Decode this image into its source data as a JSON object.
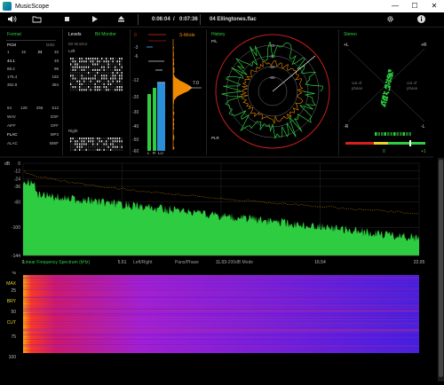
{
  "window": {
    "title": "MusicScope",
    "minimize": "—",
    "maximize": "☐",
    "close": "✕"
  },
  "toolbar": {
    "elapsed": "0:06:04",
    "separator": "/",
    "total": "0:07:36",
    "track": "04 Ellingtones.flac"
  },
  "format": {
    "title": "Format",
    "header_left": "PCM",
    "header_right": "DSD",
    "bits": [
      "1",
      "16",
      "24",
      "32"
    ],
    "rates_left": [
      "44.1",
      "88.2",
      "176.4",
      "352.8"
    ],
    "rates_right": [
      "48",
      "96",
      "192",
      "384"
    ],
    "dsd_rates": [
      "64",
      "128",
      "256",
      "512"
    ],
    "codecs_left": [
      "WAV",
      "AIFF",
      "FLAC",
      "ALAC"
    ],
    "codecs_right": [
      "DSF",
      "DFF",
      "MP3",
      "BWF"
    ]
  },
  "levels": {
    "title": "Levels",
    "title2": "Bit Monitor",
    "sub": "Bit Monitor",
    "left": "Left",
    "right": "Right"
  },
  "smode": {
    "label": "S-Mode",
    "value": "7.0",
    "scale": [
      "0",
      "-3",
      "-6",
      "-12",
      "-20",
      "-30",
      "-40",
      "-50",
      "-60"
    ],
    "lr": [
      "L",
      "R",
      "LU"
    ]
  },
  "history": {
    "title": "History",
    "top": "P/L",
    "bottom": "PLR"
  },
  "stereo": {
    "title": "Stereo",
    "pl": "+L",
    "pr": "+R",
    "ml": "-R",
    "mr": "-L",
    "oop1": "out of phase",
    "oop2": "out of phase",
    "bal_center": "0",
    "bal_right": "+1"
  },
  "spectrum": {
    "db_label": "dB",
    "yticks": [
      "0",
      "-12",
      "-24",
      "-36",
      "-60",
      "-100",
      "-144"
    ],
    "mode": "Linear Frequency Spectrum (kHz)",
    "xticks": [
      "0",
      "5.51",
      "11.03",
      "16.54",
      "22.05"
    ],
    "opt1": "Left/Right",
    "opt2": "Pans/Phase",
    "opt3": "-200dB Mode"
  },
  "spectrogram": {
    "yticks": [
      "%",
      "MAX",
      "25",
      "BRY",
      "50",
      "CUT",
      "75",
      "100"
    ]
  },
  "colors": {
    "green": "#2ecc40",
    "orange": "#f08a00",
    "red": "#e52b1e",
    "blue": "#2a8fd8"
  }
}
